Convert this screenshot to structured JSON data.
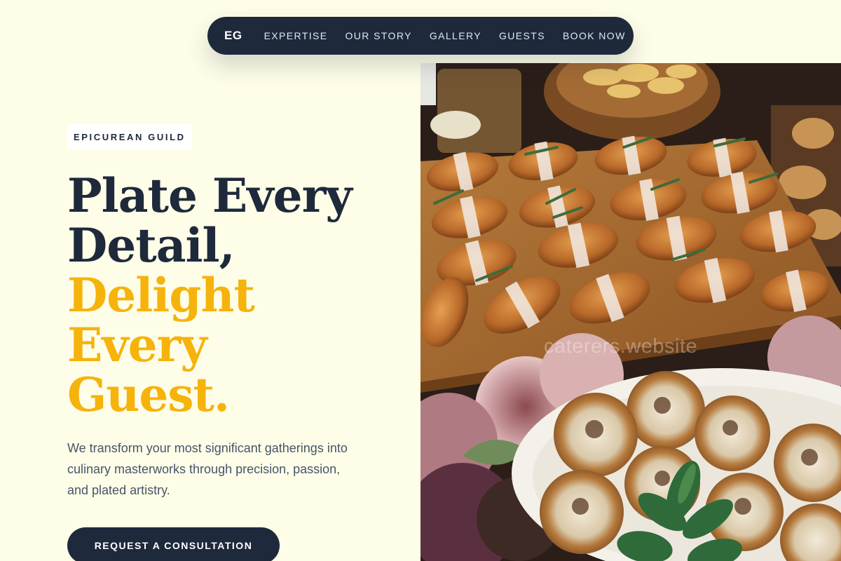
{
  "nav": {
    "logo": "EG",
    "links": [
      "EXPERTISE",
      "OUR STORY",
      "GALLERY",
      "GUESTS",
      "BOOK NOW"
    ]
  },
  "hero": {
    "eyebrow": "EPICUREAN GUILD",
    "headline_dark": [
      "Plate Every",
      "Detail,"
    ],
    "headline_gold": [
      "Delight",
      "Every",
      "Guest."
    ],
    "lead": "We transform your most significant gatherings into culinary masterworks through precision, passion, and plated artistry.",
    "cta": "REQUEST A CONSULTATION"
  },
  "image": {
    "watermark": "caterers.website"
  },
  "colors": {
    "background": "#fefde8",
    "navy": "#1e293b",
    "gold": "#f5b30b",
    "body_text": "#475569"
  }
}
